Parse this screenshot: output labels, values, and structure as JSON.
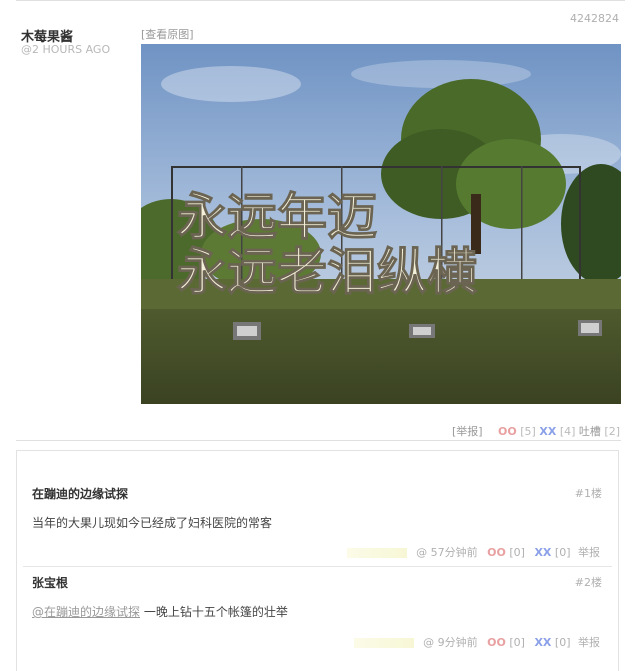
{
  "post": {
    "author": "木莓果酱",
    "time": "@2 HOURS AGO",
    "id": "4242824",
    "view_original": "[查看原图]",
    "image_caption_line1": "永远年迈",
    "image_caption_line2": "永远老泪纵横",
    "report": "[举报]",
    "oo_label": "OO",
    "oo_count": "[5]",
    "xx_label": "XX",
    "xx_count": "[4]",
    "tucao_label": "吐槽",
    "tucao_count": "[2]"
  },
  "comments": [
    {
      "author": "在蹦迪的边缘试探",
      "floor": "#1楼",
      "mention": "",
      "text": "当年的大果儿现如今已经成了妇科医院的常客",
      "time": "@ 57分钟前",
      "oo_label": "OO",
      "oo_count": "[0]",
      "xx_label": "XX",
      "xx_count": "[0]",
      "report": "举报"
    },
    {
      "author": "张宝根",
      "floor": "#2楼",
      "mention": "@在蹦迪的边缘试探",
      "text": " 一晚上钻十五个帐篷的壮举",
      "time": "@ 9分钟前",
      "oo_label": "OO",
      "oo_count": "[0]",
      "xx_label": "XX",
      "xx_count": "[0]",
      "report": "举报"
    }
  ],
  "colors": {
    "oo": "#e8a0a0",
    "xx": "#8aa0e8",
    "caption": "#f3efd8"
  }
}
